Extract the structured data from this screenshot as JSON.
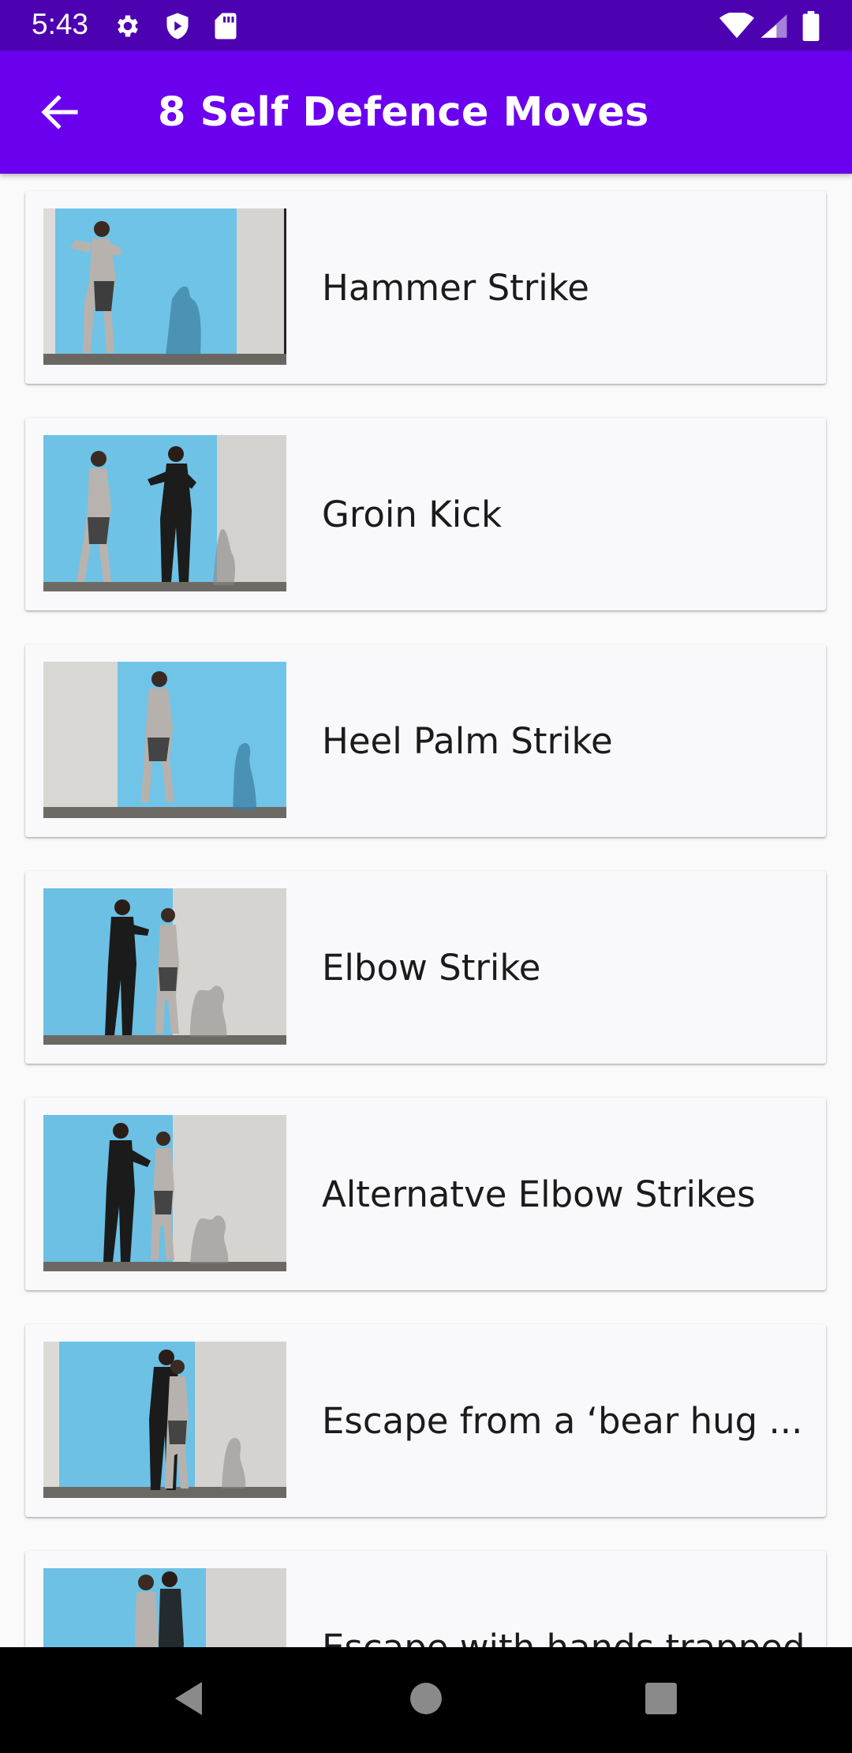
{
  "status_bar": {
    "time": "5:43",
    "icons_left": [
      "settings-icon",
      "shield-icon",
      "sd-card-icon"
    ],
    "icons_right": [
      "wifi-icon",
      "signal-icon",
      "battery-icon"
    ]
  },
  "app_bar": {
    "back_icon": "arrow-back-icon",
    "title": "8 Self Defence Moves",
    "color": "#6a00ee"
  },
  "moves": [
    {
      "title": "Hammer Strike"
    },
    {
      "title": "Groin Kick"
    },
    {
      "title": "Heel Palm Strike"
    },
    {
      "title": "Elbow Strike"
    },
    {
      "title": "Alternatve Elbow Strikes"
    },
    {
      "title": "Escape from a ‘bear hug ..."
    },
    {
      "title": "Escape with hands trapped"
    }
  ],
  "nav_bar": {
    "buttons": [
      "back-triangle-icon",
      "home-circle-icon",
      "recents-square-icon"
    ]
  }
}
